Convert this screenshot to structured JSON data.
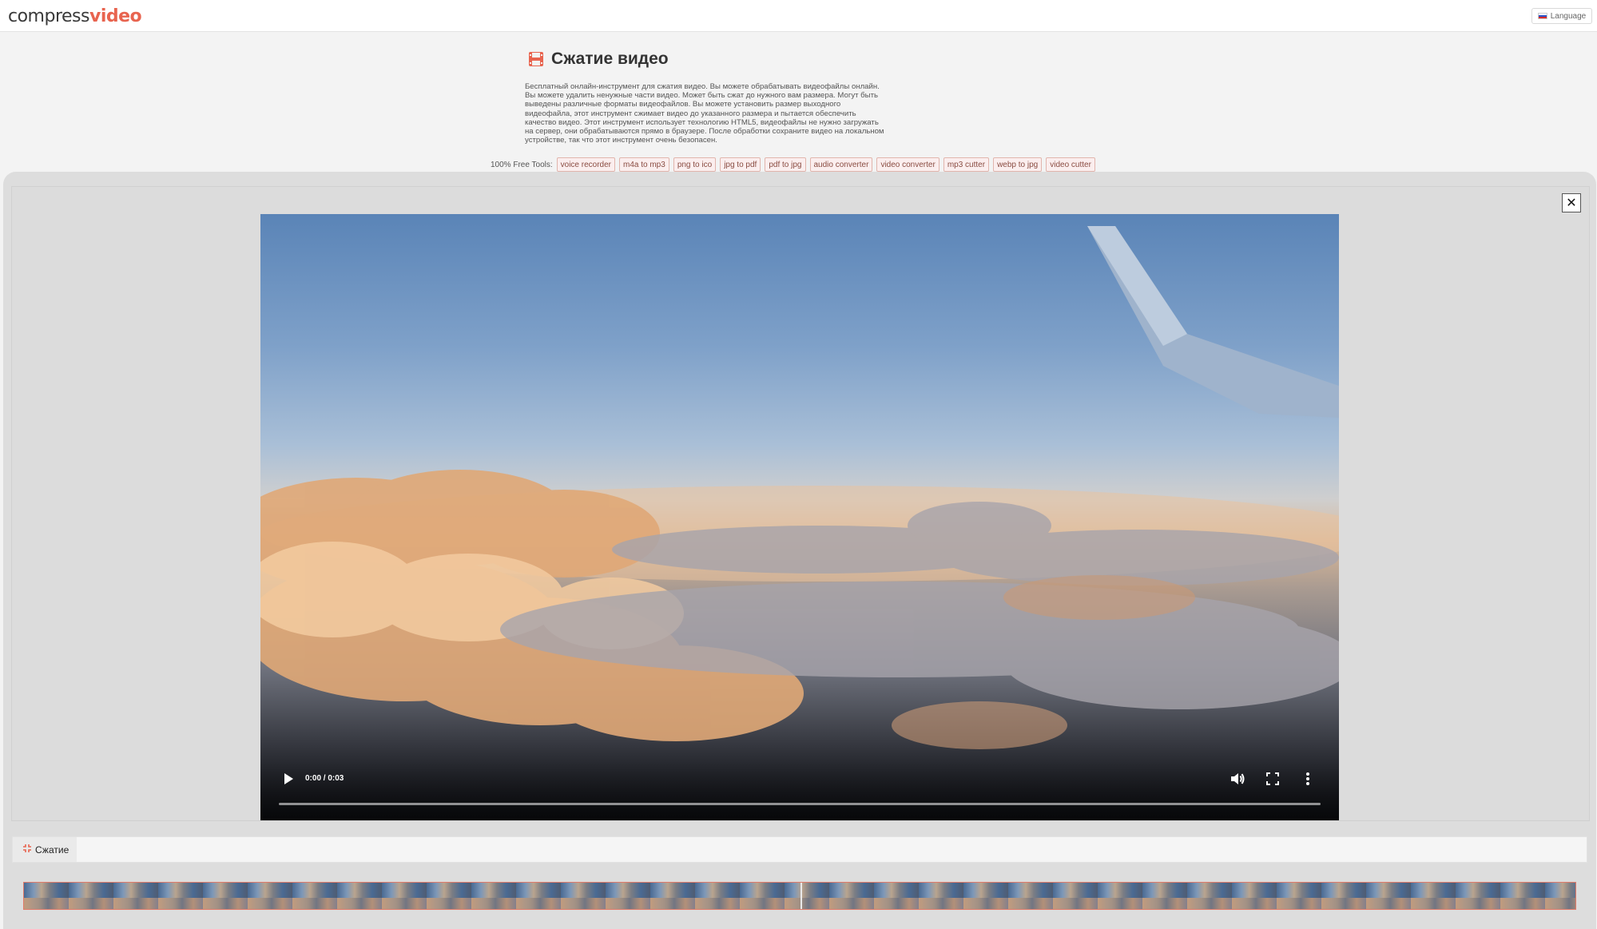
{
  "header": {
    "logo_part1": "compress",
    "logo_part2": "video",
    "language_label": "Language"
  },
  "intro": {
    "title": "Сжатие видео",
    "description": "Бесплатный онлайн-инструмент для сжатия видео. Вы можете обрабатывать видеофайлы онлайн. Вы можете удалить ненужные части видео. Может быть сжат до нужного вам размера. Могут быть выведены различные форматы видеофайлов. Вы можете установить размер выходного видеофайла, этот инструмент сжимает видео до указанного размера и пытается обеспечить качество видео. Этот инструмент использует технологию HTML5, видеофайлы не нужно загружать на сервер, они обрабатываются прямо в браузере. После обработки сохраните видео на локальном устройстве, так что этот инструмент очень безопасен."
  },
  "tools": {
    "label": "100% Free Tools:",
    "items": [
      "voice recorder",
      "m4a to mp3",
      "png to ico",
      "jpg to pdf",
      "pdf to jpg",
      "audio converter",
      "video converter",
      "mp3 cutter",
      "webp to jpg",
      "video cutter"
    ]
  },
  "editor": {
    "close_label": "✕",
    "player": {
      "time": "0:00 / 0:03",
      "progress": 0
    },
    "compress_label": "Сжатие"
  },
  "colors": {
    "accent": "#e8644f",
    "panel": "#dddddd"
  },
  "icons": [
    "film-icon",
    "language-flag-icon",
    "close-icon",
    "play-icon",
    "volume-icon",
    "fullscreen-icon",
    "more-vert-icon",
    "compress-icon"
  ]
}
